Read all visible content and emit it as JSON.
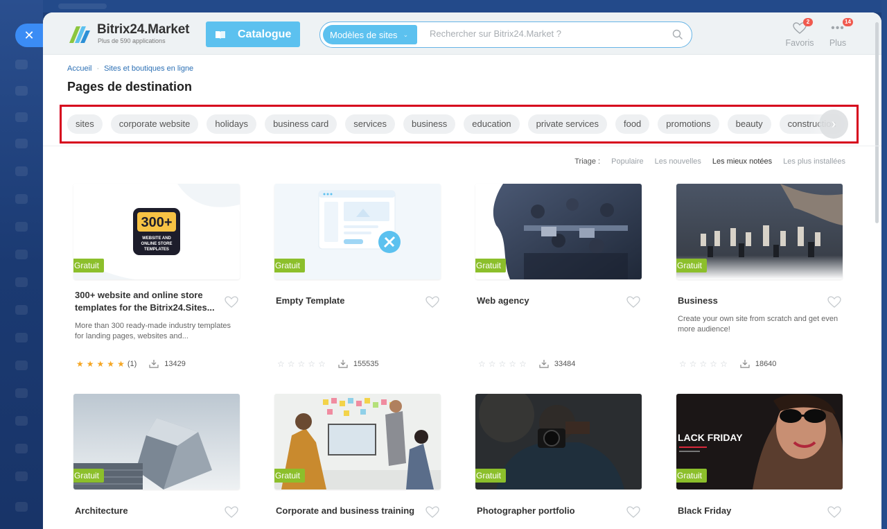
{
  "app": {
    "logo_title": "Bitrix24.Market",
    "logo_subtitle": "Plus de 590 applications",
    "catalogue_label": "Catalogue",
    "search_scope": "Modèles de sites",
    "search_placeholder": "Rechercher sur Bitrix24.Market ?",
    "favorites_label": "Favoris",
    "favorites_count": "2",
    "more_label": "Plus",
    "more_count": "14",
    "accent_color": "#5cc1ef",
    "badge_color": "#f05a4f",
    "free_color": "#8cbf2b"
  },
  "breadcrumb": [
    "Accueil",
    "Sites et boutiques en ligne"
  ],
  "page_title": "Pages de destination",
  "tags": [
    "sites",
    "corporate website",
    "holidays",
    "business card",
    "services",
    "business",
    "education",
    "private services",
    "food",
    "promotions",
    "beauty",
    "construction"
  ],
  "sort": {
    "label": "Triage :",
    "options": [
      "Populaire",
      "Les nouvelles",
      "Les mieux notées",
      "Les plus installées"
    ],
    "active": "Les mieux notées"
  },
  "cards": [
    {
      "title": "300+ website and online store templates for the Bitrix24.Sites...",
      "badge": "Gratuit",
      "description": "More than 300 ready-made industry templates for landing pages, websites and...",
      "rating": 5,
      "reviews": "(1)",
      "installs": "13429",
      "image": "300plus-templates-icon",
      "logo_big": "300+",
      "logo_small": "WEBSITE AND ONLINE STORE TEMPLATES"
    },
    {
      "title": "Empty Template",
      "badge": "Gratuit",
      "description": "",
      "rating": 0,
      "reviews": "",
      "installs": "155535",
      "image": "empty-template-illustration"
    },
    {
      "title": "Web agency",
      "badge": "Gratuit",
      "description": "",
      "rating": 0,
      "reviews": "",
      "installs": "33484",
      "image": "office-team-photo"
    },
    {
      "title": "Business",
      "badge": "Gratuit",
      "description": "Create your own site from scratch and get even more audience!",
      "rating": 0,
      "reviews": "",
      "installs": "18640",
      "image": "chess-photo"
    },
    {
      "title": "Architecture",
      "badge": "Gratuit",
      "image": "building-photo"
    },
    {
      "title": "Corporate and business training",
      "badge": "Gratuit",
      "image": "meeting-photo"
    },
    {
      "title": "Photographer portfolio",
      "badge": "Gratuit",
      "image": "photographer-photo"
    },
    {
      "title": "Black Friday",
      "badge": "Gratuit",
      "image": "black-friday-photo",
      "image_text": "LACK FRIDAY"
    }
  ]
}
